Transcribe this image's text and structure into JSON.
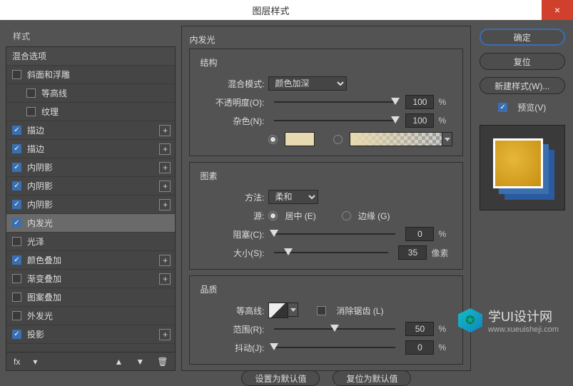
{
  "window": {
    "title": "图层样式",
    "close": "×"
  },
  "left": {
    "header": "样式",
    "rows": [
      {
        "label": "混合选项",
        "indent": false,
        "checked": null,
        "plus": false,
        "sel": false,
        "hdr": true
      },
      {
        "label": "斜面和浮雕",
        "indent": false,
        "checked": false,
        "plus": false,
        "sel": false
      },
      {
        "label": "等高线",
        "indent": true,
        "checked": false,
        "plus": false,
        "sel": false
      },
      {
        "label": "纹理",
        "indent": true,
        "checked": false,
        "plus": false,
        "sel": false
      },
      {
        "label": "描边",
        "indent": false,
        "checked": true,
        "plus": true,
        "sel": false
      },
      {
        "label": "描边",
        "indent": false,
        "checked": true,
        "plus": true,
        "sel": false
      },
      {
        "label": "内阴影",
        "indent": false,
        "checked": true,
        "plus": true,
        "sel": false
      },
      {
        "label": "内阴影",
        "indent": false,
        "checked": true,
        "plus": true,
        "sel": false
      },
      {
        "label": "内阴影",
        "indent": false,
        "checked": true,
        "plus": true,
        "sel": false
      },
      {
        "label": "内发光",
        "indent": false,
        "checked": true,
        "plus": false,
        "sel": true
      },
      {
        "label": "光泽",
        "indent": false,
        "checked": false,
        "plus": false,
        "sel": false
      },
      {
        "label": "颜色叠加",
        "indent": false,
        "checked": true,
        "plus": true,
        "sel": false
      },
      {
        "label": "渐变叠加",
        "indent": false,
        "checked": false,
        "plus": true,
        "sel": false
      },
      {
        "label": "图案叠加",
        "indent": false,
        "checked": false,
        "plus": false,
        "sel": false
      },
      {
        "label": "外发光",
        "indent": false,
        "checked": false,
        "plus": false,
        "sel": false
      },
      {
        "label": "投影",
        "indent": false,
        "checked": true,
        "plus": true,
        "sel": false
      }
    ],
    "toolbar": {
      "fx": "fx",
      "up": "▲",
      "down": "▼",
      "trash": "🗑"
    }
  },
  "panel": {
    "title": "内发光",
    "structure": {
      "title": "结构",
      "blendMode": {
        "label": "混合模式:",
        "value": "颜色加深"
      },
      "opacity": {
        "label": "不透明度(O):",
        "value": "100",
        "unit": "%",
        "pos": 100
      },
      "noise": {
        "label": "杂色(N):",
        "value": "100",
        "unit": "%",
        "pos": 100
      },
      "swatch": "#e8dab0"
    },
    "elements": {
      "title": "图素",
      "technique": {
        "label": "方法:",
        "value": "柔和"
      },
      "source": {
        "label": "源:",
        "center": "居中 (E)",
        "edge": "边缘 (G)"
      },
      "choke": {
        "label": "阻塞(C):",
        "value": "0",
        "unit": "%",
        "pos": 0
      },
      "size": {
        "label": "大小(S):",
        "value": "35",
        "unit": "像素",
        "pos": 12
      }
    },
    "quality": {
      "title": "品质",
      "contour": {
        "label": "等高线:"
      },
      "antialias": "消除锯齿 (L)",
      "range": {
        "label": "范围(R):",
        "value": "50",
        "unit": "%",
        "pos": 50
      },
      "jitter": {
        "label": "抖动(J):",
        "value": "0",
        "unit": "%",
        "pos": 0
      }
    },
    "buttons": {
      "default": "设置为默认值",
      "reset": "复位为默认值"
    }
  },
  "right": {
    "ok": "确定",
    "cancel": "复位",
    "newStyle": "新建样式(W)...",
    "preview": "预览(V)"
  },
  "watermark": {
    "t1": "学UI设计网",
    "t2": "www.xueuisheji.com"
  }
}
